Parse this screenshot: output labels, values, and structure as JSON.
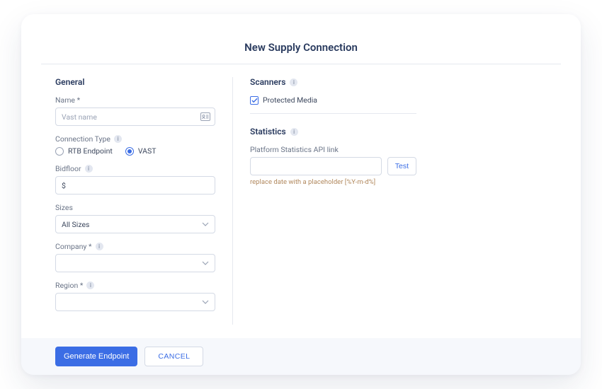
{
  "page_title": "New Supply Connection",
  "general": {
    "section_title": "General",
    "name": {
      "label": "Name *",
      "placeholder": "Vast name",
      "value": ""
    },
    "connection_type": {
      "label": "Connection Type",
      "options": [
        {
          "label": "RTB Endpoint",
          "checked": false
        },
        {
          "label": "VAST",
          "checked": true
        }
      ]
    },
    "bidfloor": {
      "label": "Bidfloor",
      "value": "$"
    },
    "sizes": {
      "label": "Sizes",
      "value": "All Sizes"
    },
    "company": {
      "label": "Company *",
      "value": ""
    },
    "region": {
      "label": "Region *",
      "value": ""
    }
  },
  "scanners": {
    "section_title": "Scanners",
    "protected_media": {
      "label": "Protected Media",
      "checked": true
    }
  },
  "statistics": {
    "section_title": "Statistics",
    "api_link": {
      "label": "Platform Statistics API link",
      "value": ""
    },
    "test_button": "Test",
    "hint": "replace date with a placeholder [%Y-m-d%]"
  },
  "footer": {
    "generate_label": "Generate Endpoint",
    "cancel_label": "CANCEL"
  }
}
